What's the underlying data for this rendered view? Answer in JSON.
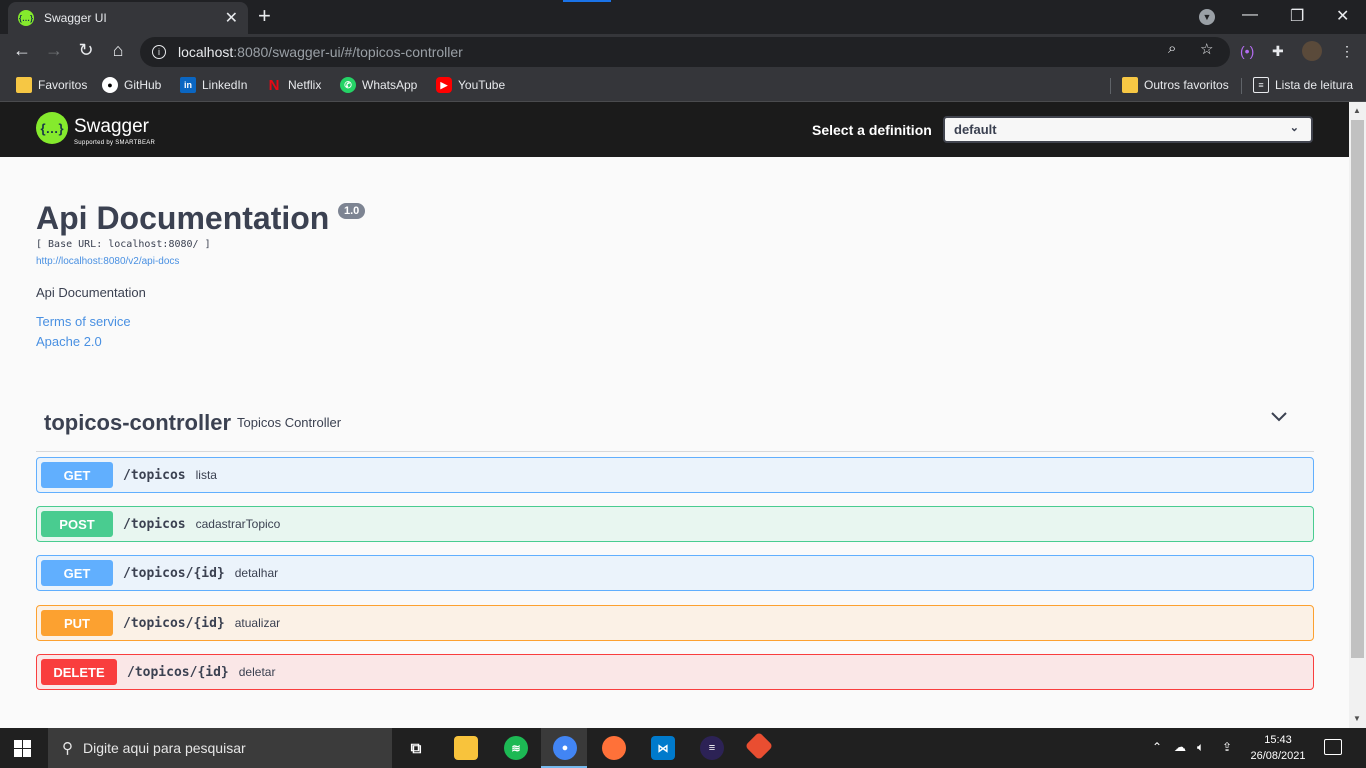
{
  "browser": {
    "tab_title": "Swagger UI",
    "tab_close": "✕",
    "new_tab": "+",
    "window_controls": {
      "minimize": "—",
      "maximize": "❐",
      "close": "✕"
    },
    "url_host": "localhost",
    "url_rest": ":8080/swagger-ui/#/topicos-controller",
    "bookmarks": [
      {
        "label": "Favoritos",
        "icon": "folder-icon"
      },
      {
        "label": "GitHub",
        "icon": "github-icon"
      },
      {
        "label": "LinkedIn",
        "icon": "linkedin-icon"
      },
      {
        "label": "Netflix",
        "icon": "netflix-icon"
      },
      {
        "label": "WhatsApp",
        "icon": "whatsapp-icon"
      },
      {
        "label": "YouTube",
        "icon": "youtube-icon"
      }
    ],
    "bookmarks_right": [
      {
        "label": "Outros favoritos",
        "icon": "folder-icon"
      },
      {
        "label": "Lista de leitura",
        "icon": "reading-list-icon"
      }
    ]
  },
  "swagger": {
    "logo_text": "Swagger",
    "logo_sub": "Supported by SMARTBEAR",
    "definition_label": "Select a definition",
    "definition_value": "default"
  },
  "info": {
    "title": "Api Documentation",
    "version": "1.0",
    "base_url": "[ Base URL: localhost:8080/ ]",
    "api_docs_link": "http://localhost:8080/v2/api-docs",
    "description": "Api Documentation",
    "terms": "Terms of service",
    "license": "Apache 2.0"
  },
  "controller": {
    "name": "topicos-controller",
    "description": "Topicos Controller",
    "operations": [
      {
        "method": "GET",
        "path": "/topicos",
        "summary": "lista"
      },
      {
        "method": "POST",
        "path": "/topicos",
        "summary": "cadastrarTopico"
      },
      {
        "method": "GET",
        "path": "/topicos/{id}",
        "summary": "detalhar"
      },
      {
        "method": "PUT",
        "path": "/topicos/{id}",
        "summary": "atualizar"
      },
      {
        "method": "DELETE",
        "path": "/topicos/{id}",
        "summary": "deletar"
      }
    ]
  },
  "taskbar": {
    "search_placeholder": "Digite aqui para pesquisar",
    "time": "15:43",
    "date": "26/08/2021"
  },
  "colors": {
    "get": "#61affe",
    "post": "#49cc90",
    "put": "#fca130",
    "delete": "#f93e3e",
    "swagger_green": "#85ea2d"
  }
}
